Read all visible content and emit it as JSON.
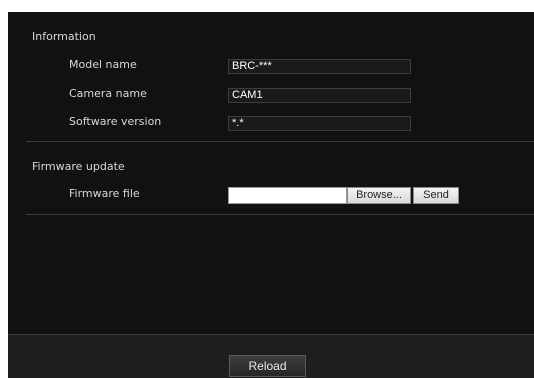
{
  "information": {
    "title": "Information",
    "fields": [
      {
        "label": "Model name",
        "value": "BRC-***"
      },
      {
        "label": "Camera name",
        "value": "CAM1"
      },
      {
        "label": "Software version",
        "value": "*.*"
      }
    ]
  },
  "firmware": {
    "title": "Firmware update",
    "file_label": "Firmware file",
    "file_value": "",
    "browse_label": "Browse...",
    "send_label": "Send"
  },
  "footer": {
    "reload_label": "Reload"
  }
}
